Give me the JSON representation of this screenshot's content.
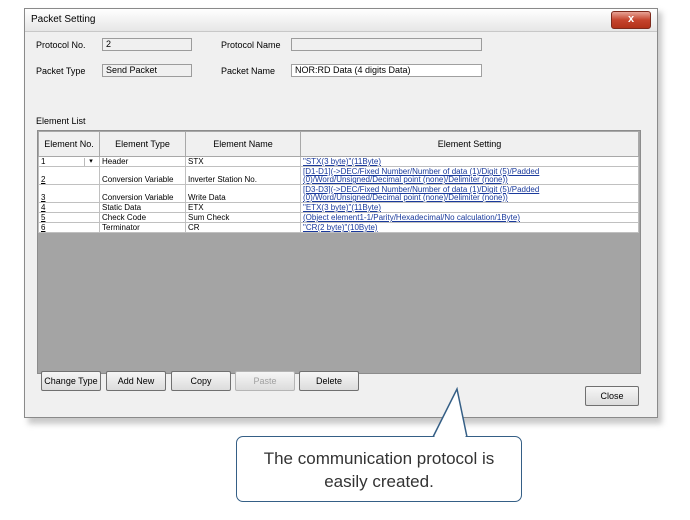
{
  "window": {
    "title": "Packet Setting",
    "close_glyph": "x"
  },
  "form": {
    "protocol_no_label": "Protocol No.",
    "protocol_no_value": "2",
    "protocol_name_label": "Protocol Name",
    "protocol_name_value": "",
    "packet_type_label": "Packet Type",
    "packet_type_value": "Send Packet",
    "packet_name_label": "Packet Name",
    "packet_name_value": "NOR:RD Data (4 digits Data)"
  },
  "element_list": {
    "label": "Element List",
    "columns": [
      "Element No.",
      "Element Type",
      "Element Name",
      "Element Setting"
    ],
    "rows": [
      {
        "no": "1",
        "type": "Header",
        "name": "STX",
        "setting": "\"STX(3 byte)\"(11Byte)"
      },
      {
        "no": "2",
        "type": "Conversion Variable",
        "name": "Inverter Station No.",
        "setting": "[D1-D1](->DEC/Fixed Number/Number of data (1)/Digit (5)/Padded (0)/Word/Unsigned/Decimal point (none)/Delimiter (none))"
      },
      {
        "no": "3",
        "type": "Conversion Variable",
        "name": "Write Data",
        "setting": "[D3-D3](->DEC/Fixed Number/Number of data (1)/Digit (5)/Padded (0)/Word/Unsigned/Decimal point (none)/Delimiter (none))"
      },
      {
        "no": "4",
        "type": "Static Data",
        "name": "ETX",
        "setting": "\"ETX(3 byte)\"(11Byte)"
      },
      {
        "no": "5",
        "type": "Check Code",
        "name": "Sum Check",
        "setting": "(Object element1-1/Parity/Hexadecimal/No calculation/1Byte)"
      },
      {
        "no": "6",
        "type": "Terminator",
        "name": "CR",
        "setting": "\"CR(2 byte)\"(10Byte)"
      }
    ]
  },
  "buttons": {
    "change_type": "Change Type",
    "add_new": "Add New",
    "copy": "Copy",
    "paste": "Paste",
    "delete": "Delete",
    "close": "Close"
  },
  "callout": {
    "line1": "The communication protocol is",
    "line2": "easily created.",
    "border_color": "#355f86"
  }
}
